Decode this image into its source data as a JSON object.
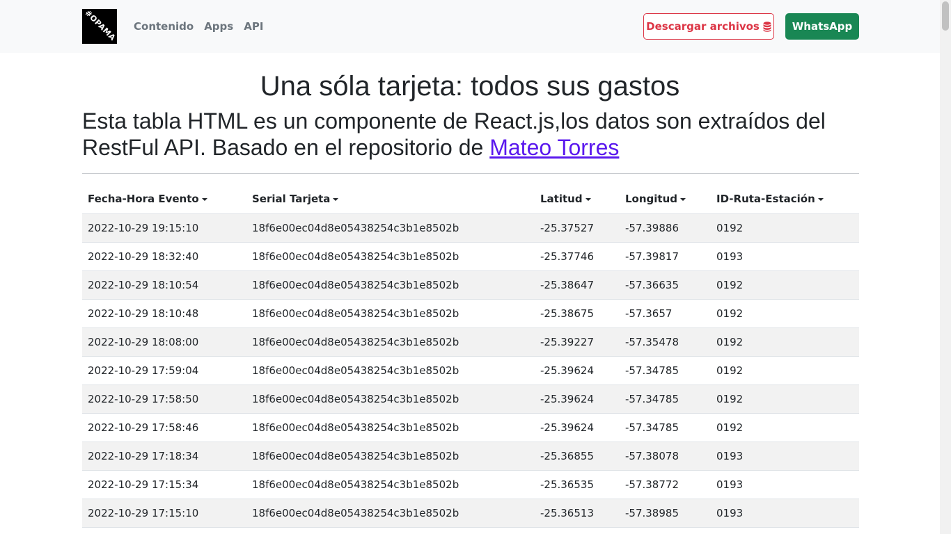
{
  "navbar": {
    "logo_text": "#OPAMA",
    "links": [
      "Contenido",
      "Apps",
      "API"
    ],
    "download_label": "Descargar archivos",
    "whatsapp_label": "WhatsApp"
  },
  "main": {
    "title": "Una sóla tarjeta: todos sus gastos",
    "subtitle_text": "Esta tabla HTML es un componente de React.js,los datos son extraídos del RestFul API. Basado en el repositorio de ",
    "subtitle_link": "Mateo Torres"
  },
  "table": {
    "headers": [
      "Fecha-Hora Evento",
      "Serial Tarjeta",
      "Latitud",
      "Longitud",
      "ID-Ruta-Estación"
    ],
    "rows": [
      [
        "2022-10-29 19:15:10",
        "18f6e00ec04d8e05438254c3b1e8502b",
        "-25.37527",
        "-57.39886",
        "0192"
      ],
      [
        "2022-10-29 18:32:40",
        "18f6e00ec04d8e05438254c3b1e8502b",
        "-25.37746",
        "-57.39817",
        "0193"
      ],
      [
        "2022-10-29 18:10:54",
        "18f6e00ec04d8e05438254c3b1e8502b",
        "-25.38647",
        "-57.36635",
        "0192"
      ],
      [
        "2022-10-29 18:10:48",
        "18f6e00ec04d8e05438254c3b1e8502b",
        "-25.38675",
        "-57.3657",
        "0192"
      ],
      [
        "2022-10-29 18:08:00",
        "18f6e00ec04d8e05438254c3b1e8502b",
        "-25.39227",
        "-57.35478",
        "0192"
      ],
      [
        "2022-10-29 17:59:04",
        "18f6e00ec04d8e05438254c3b1e8502b",
        "-25.39624",
        "-57.34785",
        "0192"
      ],
      [
        "2022-10-29 17:58:50",
        "18f6e00ec04d8e05438254c3b1e8502b",
        "-25.39624",
        "-57.34785",
        "0192"
      ],
      [
        "2022-10-29 17:58:46",
        "18f6e00ec04d8e05438254c3b1e8502b",
        "-25.39624",
        "-57.34785",
        "0192"
      ],
      [
        "2022-10-29 17:18:34",
        "18f6e00ec04d8e05438254c3b1e8502b",
        "-25.36855",
        "-57.38078",
        "0193"
      ],
      [
        "2022-10-29 17:15:34",
        "18f6e00ec04d8e05438254c3b1e8502b",
        "-25.36535",
        "-57.38772",
        "0193"
      ],
      [
        "2022-10-29 17:15:10",
        "18f6e00ec04d8e05438254c3b1e8502b",
        "-25.36513",
        "-57.38985",
        "0193"
      ]
    ]
  },
  "colors": {
    "download_accent": "#dc3545",
    "whatsapp_bg": "#198754",
    "link": "#5a18ee"
  }
}
